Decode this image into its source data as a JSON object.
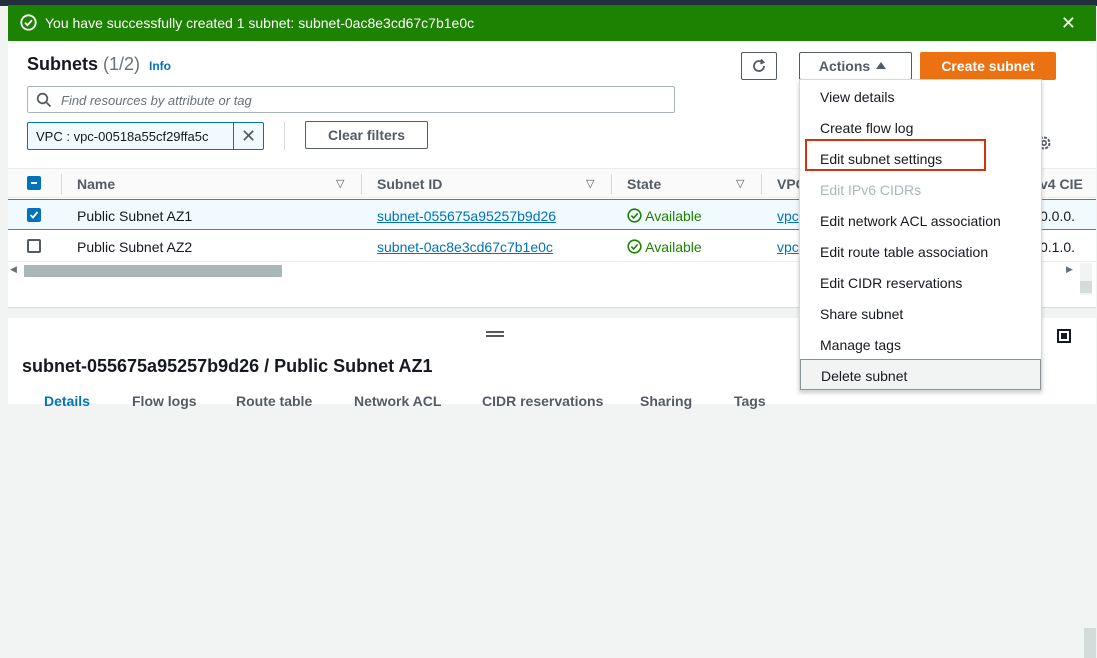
{
  "flash": {
    "message": "You have successfully created 1 subnet: subnet-0ac8e3cd67c7b1e0c",
    "close": "✕"
  },
  "header": {
    "title": "Subnets",
    "count": "(1/2)",
    "info": "Info",
    "actions_label": "Actions",
    "create_label": "Create subnet"
  },
  "search": {
    "placeholder": "Find resources by attribute or tag"
  },
  "filter": {
    "token": "VPC : vpc-00518a55cf29ffa5c",
    "clear_label": "Clear filters"
  },
  "table": {
    "columns": [
      "Name",
      "Subnet ID",
      "State",
      "VPC",
      "v4 CIE"
    ],
    "rows": [
      {
        "name": "Public Subnet AZ1",
        "subnet_id": "subnet-055675a95257b9d26",
        "state": "Available",
        "vpc": "vpc",
        "cidr": "0.0.0.",
        "selected": true
      },
      {
        "name": "Public Subnet AZ2",
        "subnet_id": "subnet-0ac8e3cd67c7b1e0c",
        "state": "Available",
        "vpc": "vpc",
        "cidr": "0.1.0.",
        "selected": false
      }
    ]
  },
  "menu": {
    "items": [
      "View details",
      "Create flow log",
      "Edit subnet settings",
      "Edit IPv6 CIDRs",
      "Edit network ACL association",
      "Edit route table association",
      "Edit CIDR reservations",
      "Share subnet",
      "Manage tags",
      "Delete subnet"
    ]
  },
  "details": {
    "title": "subnet-055675a95257b9d26 / Public Subnet AZ1",
    "tabs": [
      "Details",
      "Flow logs",
      "Route table",
      "Network ACL",
      "CIDR reservations",
      "Sharing",
      "Tags"
    ]
  },
  "colors": {
    "success": "#1d8102",
    "primary": "#ec7211",
    "link": "#0073bb",
    "highlight": "#d13212"
  }
}
